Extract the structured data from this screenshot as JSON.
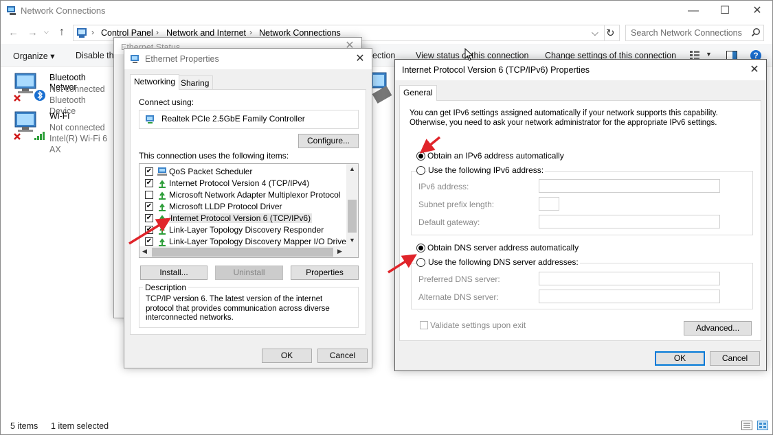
{
  "window": {
    "title": "Network Connections",
    "minimize": "—",
    "maximize": "☐",
    "close": "✕"
  },
  "nav": {
    "back": "←",
    "forward": "→",
    "up": "↑",
    "breadcrumb": [
      "Control Panel",
      "Network and Internet",
      "Network Connections"
    ],
    "sep": "›",
    "dropdown": "⌵",
    "refresh": "↻",
    "search_placeholder": "Search Network Connections"
  },
  "toolbar": {
    "organize": "Organize ▾",
    "disable": "Disable thi",
    "diagnose": "ection",
    "view_status": "View status of this connection",
    "change_settings": "Change settings of this connection",
    "help": "?"
  },
  "connections": [
    {
      "name": "Bluetooth Networ",
      "status": "Not connected",
      "device": "Bluetooth Device"
    },
    {
      "name": "Wi-Fi",
      "status": "Not connected",
      "device": "Intel(R) Wi-Fi 6 AX"
    }
  ],
  "statusbar": {
    "items": "5 items",
    "selected": "1 item selected"
  },
  "ethernet_status": {
    "title": "Ethernet Status",
    "close": "✕"
  },
  "ethernet_props": {
    "title": "Ethernet Properties",
    "close": "✕",
    "tabs": [
      "Networking",
      "Sharing"
    ],
    "connect_using_label": "Connect using:",
    "adapter": "Realtek PCIe 2.5GbE Family Controller",
    "configure": "Configure...",
    "items_label": "This connection uses the following items:",
    "items": [
      {
        "label": "QoS Packet Scheduler",
        "checked": "✔"
      },
      {
        "label": "Internet Protocol Version 4 (TCP/IPv4)",
        "checked": "✔"
      },
      {
        "label": "Microsoft Network Adapter Multiplexor Protocol",
        "checked": ""
      },
      {
        "label": "Microsoft LLDP Protocol Driver",
        "checked": "✔"
      },
      {
        "label": "Internet Protocol Version 6 (TCP/IPv6)",
        "checked": "✔"
      },
      {
        "label": "Link-Layer Topology Discovery Responder",
        "checked": "✔"
      },
      {
        "label": "Link-Layer Topology Discovery Mapper I/O Driver",
        "checked": "✔"
      }
    ],
    "install": "Install...",
    "uninstall": "Uninstall",
    "properties": "Properties",
    "description_label": "Description",
    "description": "TCP/IP version 6. The latest version of the internet protocol that provides communication across diverse interconnected networks.",
    "ok": "OK",
    "cancel": "Cancel"
  },
  "ipv6": {
    "title": "Internet Protocol Version 6 (TCP/IPv6) Properties",
    "close": "✕",
    "tab": "General",
    "intro": "You can get IPv6 settings assigned automatically if your network supports this capability. Otherwise, you need to ask your network administrator for the appropriate IPv6 settings.",
    "auto_ip": "Obtain an IPv6 address automatically",
    "manual_ip": "Use the following IPv6 address:",
    "ipv6_address": "IPv6 address:",
    "subnet_prefix": "Subnet prefix length:",
    "default_gateway": "Default gateway:",
    "auto_dns": "Obtain DNS server address automatically",
    "manual_dns": "Use the following DNS server addresses:",
    "preferred_dns": "Preferred DNS server:",
    "alternate_dns": "Alternate DNS server:",
    "validate": "Validate settings upon exit",
    "advanced": "Advanced...",
    "ok": "OK",
    "cancel": "Cancel"
  },
  "colors": {
    "accent": "#0078d7",
    "arrow": "#e0242a"
  }
}
